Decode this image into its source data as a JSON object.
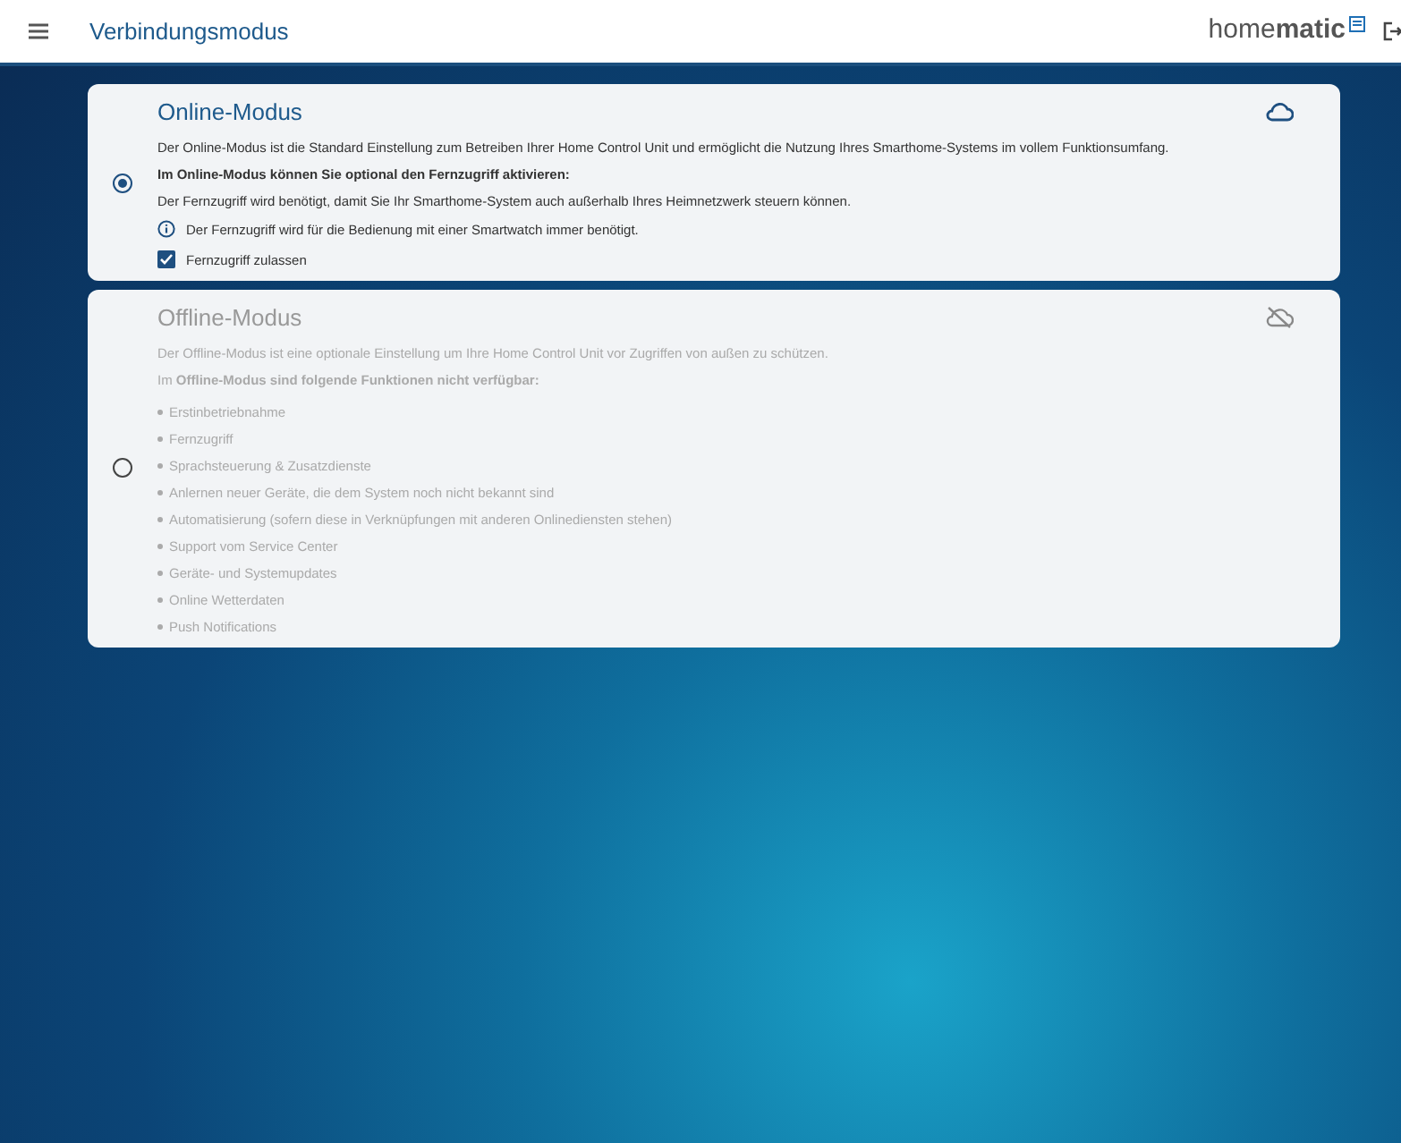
{
  "header": {
    "title": "Verbindungsmodus",
    "logo": "home**matic**"
  },
  "modes": [
    {
      "title": "Online-Modus",
      "selected": true,
      "lines": [
        {
          "text": "Der Online-Modus ist die Standard Einstellung zum Betreiben Ihrer Home Control Unit und ermöglicht die Nutzung Ihres Smarthome-Systems im vollem Funktionsumfang.",
          "kind": "text"
        },
        {
          "text": "Im Online-Modus können Sie optional den Fernzugriff aktivieren:",
          "kind": "heading"
        },
        {
          "text": "Der Fernzugriff wird benötigt, damit Sie Ihr Smarthome-System auch außerhalb Ihres Heimnetzwerk steuern können.",
          "kind": "text"
        }
      ],
      "info": "Der Fernzugriff wird für die Bedienung mit einer Smartwatch immer benötigt.",
      "checkbox": {
        "label": "Fernzugriff zulassen",
        "checked": true
      }
    },
    {
      "title": "Offline-Modus",
      "selected": false,
      "lines": [
        {
          "text": "Der Offline-Modus ist eine optionale Einstellung um Ihre Home Control Unit vor Zugriffen von außen zu schützen.",
          "kind": "text"
        },
        {
          "text": "Im **Offline-Modus sind folgende Funktionen nicht verfügbar:**",
          "kind": "text"
        }
      ],
      "bullets": [
        "Erstinbetriebnahme",
        "Fernzugriff",
        "Sprachsteuerung & Zusatzdienste",
        "Anlernen neuer Geräte, die dem System noch nicht bekannt sind",
        "Automatisierung (sofern diese in Verknüpfungen mit anderen Onlinediensten stehen)",
        "Support vom Service Center",
        "Geräte- und Systemupdates",
        "Online Wetterdaten",
        "Push Notifications"
      ]
    }
  ]
}
